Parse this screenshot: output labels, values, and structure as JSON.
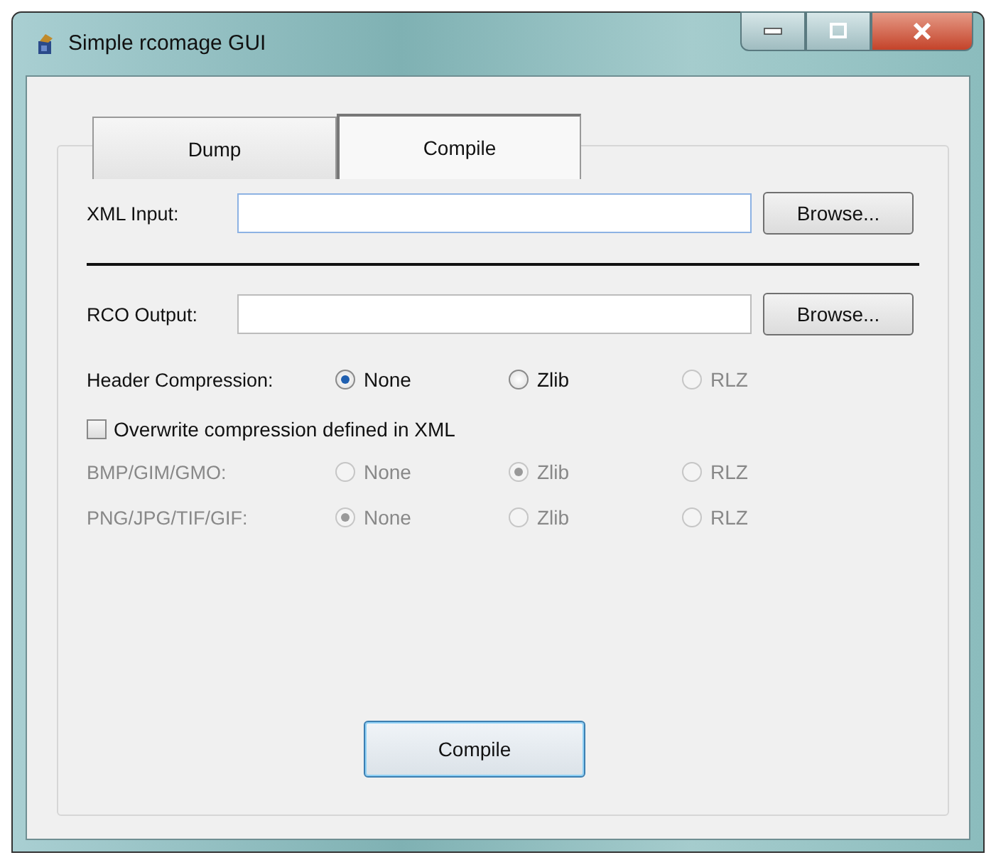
{
  "window": {
    "title": "Simple rcomage GUI"
  },
  "tabs": [
    {
      "label": "Dump",
      "selected": false
    },
    {
      "label": "Compile",
      "selected": true
    }
  ],
  "file_rows": [
    {
      "label": "XML Input:",
      "focused": true,
      "button": "Browse..."
    },
    {
      "label": "RCO Output:",
      "focused": false,
      "button": "Browse..."
    }
  ],
  "header_compression": {
    "label": "Header Compression:",
    "options": [
      {
        "label": "None",
        "selected": true,
        "disabled": false
      },
      {
        "label": "Zlib",
        "selected": false,
        "disabled": false
      },
      {
        "label": "RLZ",
        "selected": false,
        "disabled": true
      }
    ]
  },
  "overwrite": {
    "label": "Overwrite compression defined in XML",
    "checked": false
  },
  "compression_groups": [
    {
      "label": "BMP/GIM/GMO:",
      "disabled": true,
      "options": [
        {
          "label": "None",
          "selected": false,
          "disabled": true
        },
        {
          "label": "Zlib",
          "selected": true,
          "disabled": true
        },
        {
          "label": "RLZ",
          "selected": false,
          "disabled": true
        }
      ]
    },
    {
      "label": "PNG/JPG/TIF/GIF:",
      "disabled": true,
      "options": [
        {
          "label": "None",
          "selected": true,
          "disabled": true
        },
        {
          "label": "Zlib",
          "selected": false,
          "disabled": true
        },
        {
          "label": "RLZ",
          "selected": false,
          "disabled": true
        }
      ]
    }
  ],
  "action_button": "Compile"
}
